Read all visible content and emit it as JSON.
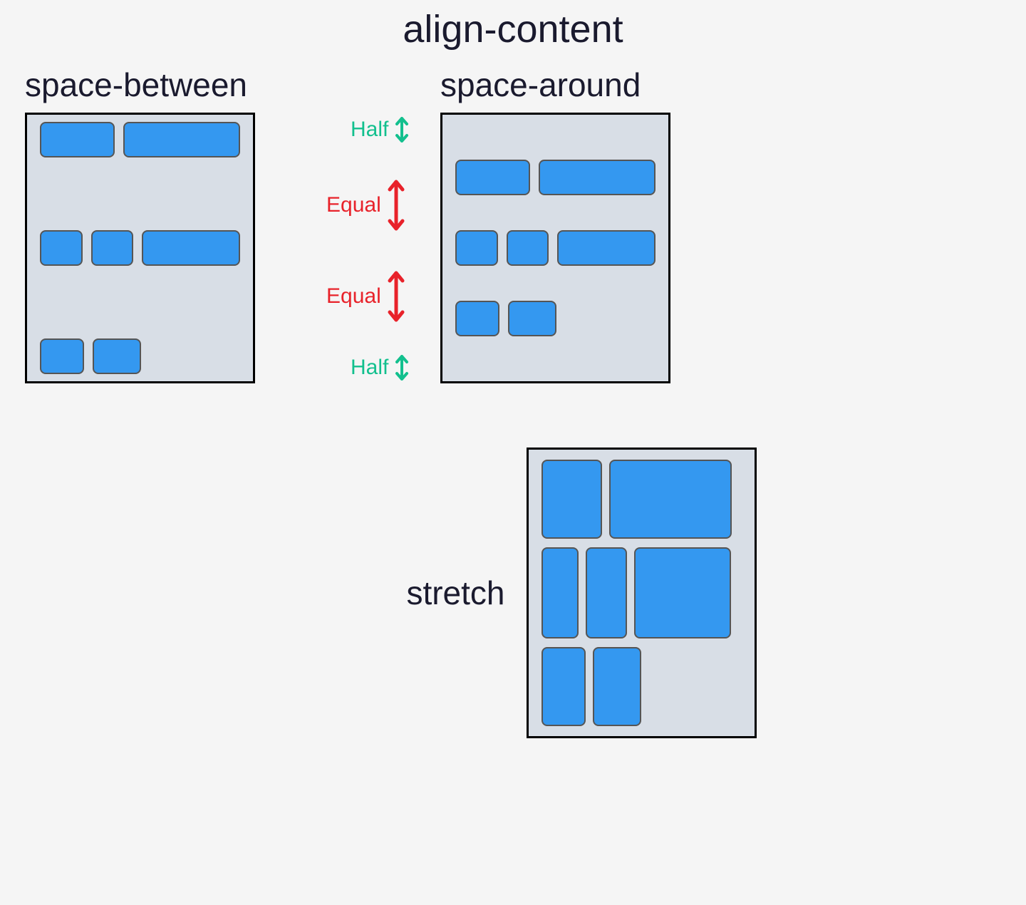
{
  "title": "align-content",
  "examples": {
    "space_between": {
      "label": "space-between"
    },
    "space_around": {
      "label": "space-around",
      "annotations": {
        "half_top": "Half",
        "equal_1": "Equal",
        "equal_2": "Equal",
        "half_bottom": "Half"
      }
    },
    "stretch": {
      "label": "stretch"
    }
  },
  "colors": {
    "box_fill": "#3498f0",
    "container_bg": "#d8dee6",
    "text": "#1a1a2e",
    "half_arrow": "#13c08e",
    "equal_arrow": "#e8222a"
  }
}
